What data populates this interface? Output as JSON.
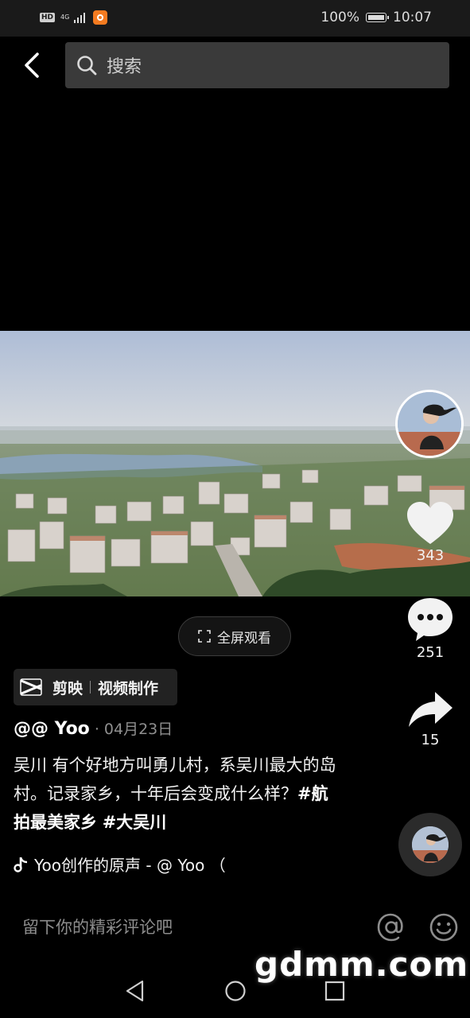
{
  "status_bar": {
    "hd": "HD",
    "network": "4G",
    "battery": "100%",
    "time": "10:07"
  },
  "search": {
    "placeholder": "搜索",
    "icon": "search-icon"
  },
  "video": {
    "fullscreen_label": "全屏观看"
  },
  "rail": {
    "likes": "343",
    "comments": "251",
    "shares": "15"
  },
  "capcut": {
    "brand": "剪映",
    "tag": "视频制作"
  },
  "post": {
    "author": "@@ Yoo",
    "date": "· 04月23日",
    "caption_text": "吴川 有个好地方叫勇儿村，系吴川最大的岛村。记录家乡，十年后会变成什么样？",
    "hashtag1": "#航拍最美家乡",
    "hashtag2": "#大吴川"
  },
  "music": {
    "title": "Yoo创作的原声 - @ Yoo （"
  },
  "comment": {
    "placeholder": "留下你的精彩评论吧"
  },
  "watermark": "gdmm.com",
  "colors": {
    "background": "#000000",
    "search_bg": "#3a3a3a",
    "accent": "#ffffff"
  }
}
